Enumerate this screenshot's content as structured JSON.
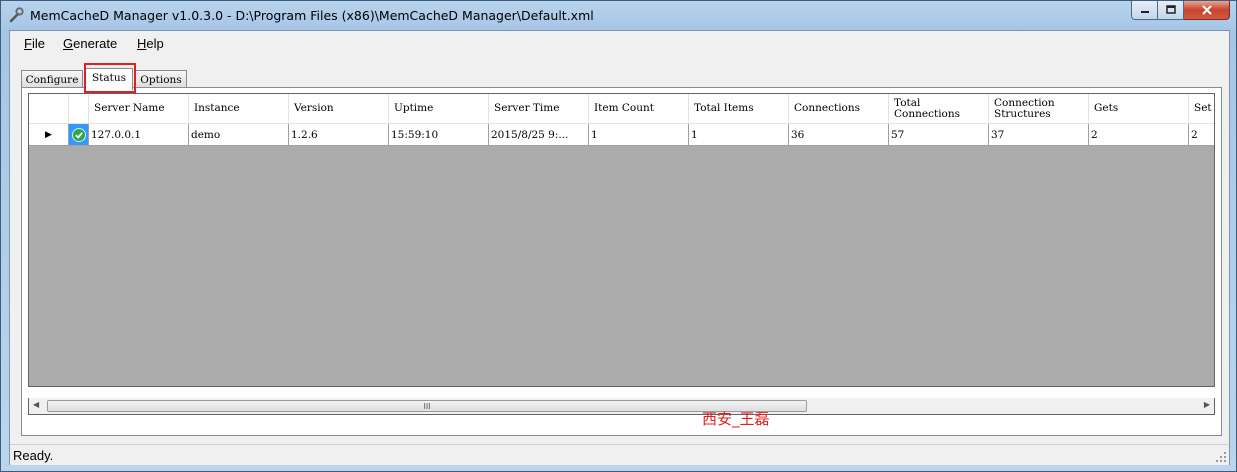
{
  "window": {
    "title": "MemCacheD Manager v1.0.3.0 - D:\\Program Files (x86)\\MemCacheD Manager\\Default.xml"
  },
  "menu": {
    "file": {
      "accel": "F",
      "rest": "ile"
    },
    "generate": {
      "accel": "G",
      "rest": "enerate"
    },
    "help": {
      "accel": "H",
      "rest": "elp"
    }
  },
  "tabs": {
    "configure": "Configure",
    "status": "Status",
    "options": "Options",
    "active": "Status"
  },
  "grid": {
    "columns": [
      "",
      "Server Name",
      "Instance",
      "Version",
      "Uptime",
      "Server Time",
      "Item Count",
      "Total Items",
      "Connections",
      "Total\nConnections",
      "Connection\nStructures",
      "Gets",
      "Set"
    ],
    "row": {
      "selector": "▶",
      "status_icon": "check-circle-icon",
      "server_name": "127.0.0.1",
      "instance": "demo",
      "version": "1.2.6",
      "uptime": "15:59:10",
      "server_time": "2015/8/25 9:...",
      "item_count": "1",
      "total_items": "1",
      "connections": "36",
      "total_connections": "57",
      "connection_structures": "37",
      "gets": "2",
      "sets": "2"
    },
    "hscroll_thumb": "III"
  },
  "watermark": "西安_王磊",
  "status": {
    "text": "Ready."
  },
  "colors": {
    "highlight": "#e02020",
    "grid_background": "#ababab",
    "status_ok": "#2fa84f"
  }
}
